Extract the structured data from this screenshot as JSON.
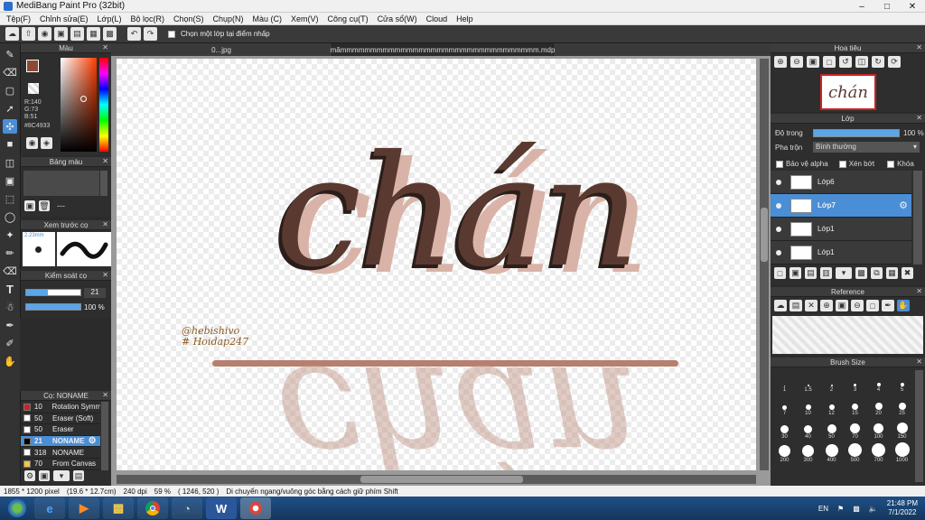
{
  "window": {
    "title": "MediBang Paint Pro (32bit)"
  },
  "menu": [
    "Tệp(F)",
    "Chỉnh sửa(E)",
    "Lớp(L)",
    "Bộ lọc(R)",
    "Chọn(S)",
    "Chụp(N)",
    "Màu (C)",
    "Xem(V)",
    "Công cụ(T)",
    "Cửa sổ(W)",
    "Cloud",
    "Help"
  ],
  "toolbar": {
    "select_layer_label": "Chọn một lớp tại điểm nhấp"
  },
  "color_panel": {
    "title": "Màu",
    "r": "R:140",
    "g": "G:73",
    "b": "B:51",
    "hex": "#8C4933",
    "primary_color": "#8C4933"
  },
  "palette_panel": {
    "title": "Bảng màu",
    "dash": "---"
  },
  "brush_preview": {
    "title": "Xem trước cọ",
    "size": "2.23mm"
  },
  "brush_control": {
    "title": "Kiểm soát cọ",
    "size_value": "21",
    "opacity_value": "100 %"
  },
  "brush_list": {
    "title": "Cọ: NONAME",
    "items": [
      {
        "size": "10",
        "name": "Rotation Symm",
        "color": "#cc2222"
      },
      {
        "size": "50",
        "name": "Eraser (Soft)",
        "color": "#ffffff"
      },
      {
        "size": "50",
        "name": "Eraser",
        "color": "#ffffff"
      },
      {
        "size": "21",
        "name": "NONAME",
        "color": "#000000"
      },
      {
        "size": "318",
        "name": "NONAME",
        "color": "#ffffff"
      },
      {
        "size": "70",
        "name": "From Canvas",
        "color": "#f4c542"
      }
    ]
  },
  "tabs": [
    "0...jpg",
    "mămmmmmmmmmmmmmmmmmmmmmmmmmmmmmmmmm.mdp"
  ],
  "canvas": {
    "main_word": "chán",
    "signature_line1": "@hebishivo",
    "signature_line2": "# Hoidap247"
  },
  "navigator": {
    "title": "Hoa tiêu",
    "thumb_text": "chán"
  },
  "layer_panel": {
    "title": "Lớp",
    "opacity_label": "Độ trong",
    "opacity_value": "100 %",
    "blend_label": "Pha trộn",
    "blend_value": "Bình thường",
    "protect_alpha": "Bảo vệ alpha",
    "clipping": "Xén bớt",
    "lock": "Khóa",
    "layers": [
      "Lớp6",
      "Lớp7",
      "Lớp1",
      "Lớp1"
    ]
  },
  "reference": {
    "title": "Reference"
  },
  "brush_size": {
    "title": "Brush Size",
    "sizes": [
      "1",
      "1.5",
      "2",
      "3",
      "4",
      "5",
      "7",
      "10",
      "12",
      "15",
      "20",
      "25",
      "30",
      "40",
      "50",
      "70",
      "100",
      "150",
      "200",
      "300",
      "400",
      "500",
      "700",
      "1000"
    ]
  },
  "status": {
    "dims": "1855 * 1200 pixel",
    "cm": "(19.6 * 12.7cm)",
    "dpi": "240 dpi",
    "zoom": "59 %",
    "coords": "( 1246, 520 )",
    "hint": "Di chuyển ngang/vuông góc bằng cách giữ phím Shift"
  },
  "taskbar": {
    "lang": "EN",
    "time": "21:48 PM",
    "date": "7/1/2022"
  }
}
